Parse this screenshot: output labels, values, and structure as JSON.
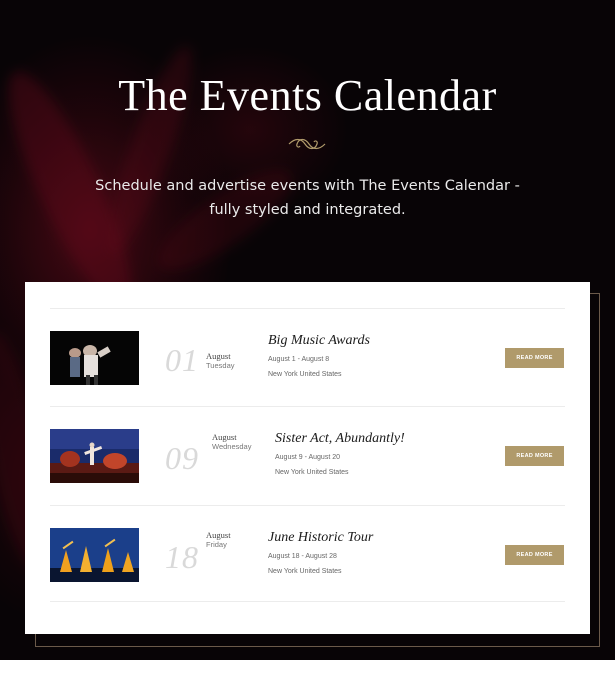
{
  "hero": {
    "title": "The Events Calendar",
    "ornament_icon": "gold-swirl-ornament",
    "subtitle": "Schedule and advertise events with The Events Calendar - fully styled and integrated.",
    "accent_color": "#b09a6b"
  },
  "events": [
    {
      "day": "01",
      "month": "August",
      "weekday": "Tuesday",
      "title": "Big Music Awards",
      "dates": "August 1 - August 8",
      "location": "New York United States",
      "button_label": "READ MORE"
    },
    {
      "day": "09",
      "month": "August",
      "weekday": "Wednesday",
      "title": "Sister Act, Abundantly!",
      "dates": "August 9 - August 20",
      "location": "New York United States",
      "button_label": "READ MORE"
    },
    {
      "day": "18",
      "month": "August",
      "weekday": "Friday",
      "title": "June Historic Tour",
      "dates": "August 18 - August 28",
      "location": "New York United States",
      "button_label": "READ MORE"
    }
  ]
}
